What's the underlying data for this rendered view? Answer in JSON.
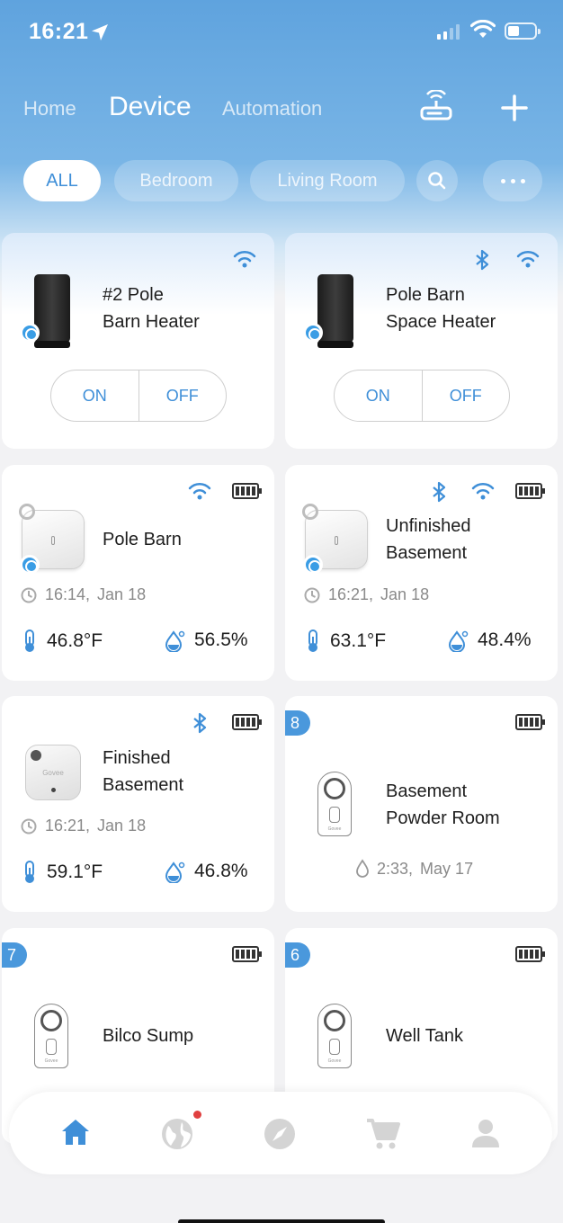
{
  "status_bar": {
    "time": "16:21"
  },
  "nav": {
    "home": "Home",
    "device": "Device",
    "automation": "Automation"
  },
  "chips": {
    "all": "ALL",
    "bedroom": "Bedroom",
    "living_room": "Living Room"
  },
  "cards": {
    "heater1": {
      "name_line1": "#2 Pole",
      "name_line2": "Barn Heater",
      "on": "ON",
      "off": "OFF"
    },
    "heater2": {
      "name_line1": "Pole Barn",
      "name_line2": "Space Heater",
      "on": "ON",
      "off": "OFF"
    },
    "pole_barn": {
      "name": "Pole Barn",
      "time": "16:14,",
      "date": "Jan 18",
      "temp": "46.8°F",
      "humidity": "56.5%"
    },
    "unfinished": {
      "name_line1": "Unfinished",
      "name_line2": "Basement",
      "time": "16:21,",
      "date": "Jan 18",
      "temp": "63.1°F",
      "humidity": "48.4%"
    },
    "finished": {
      "name_line1": "Finished",
      "name_line2": "Basement",
      "brand": "Govee",
      "time": "16:21,",
      "date": "Jan 18",
      "temp": "59.1°F",
      "humidity": "46.8%"
    },
    "powder": {
      "badge": "8",
      "name_line1": "Basement",
      "name_line2": "Powder Room",
      "brand": "Govee",
      "time": "2:33,",
      "date": "May 17"
    },
    "bilco": {
      "badge": "7",
      "name": "Bilco Sump",
      "brand": "Govee"
    },
    "well": {
      "badge": "6",
      "name": "Well Tank",
      "brand": "Govee"
    }
  },
  "tabbar": {
    "items": [
      "home-icon",
      "globe-icon",
      "compass-icon",
      "cart-icon",
      "profile-icon"
    ],
    "active": "home-icon",
    "accent": "#3f8fd8",
    "notification_color": "#e04040"
  }
}
